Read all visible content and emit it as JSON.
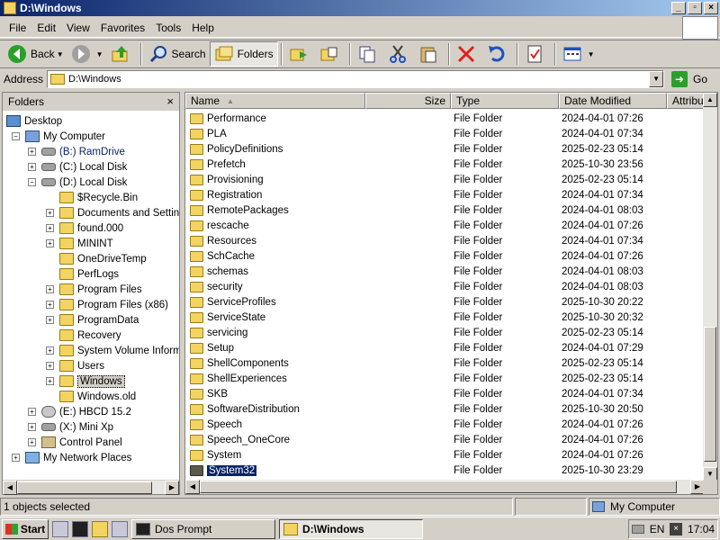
{
  "window": {
    "title": "D:\\Windows"
  },
  "menu": [
    "File",
    "Edit",
    "View",
    "Favorites",
    "Tools",
    "Help"
  ],
  "toolbar": {
    "back": "Back",
    "search": "Search",
    "folders": "Folders"
  },
  "address": {
    "label": "Address",
    "value": "D:\\Windows",
    "go": "Go"
  },
  "folders_pane": {
    "title": "Folders",
    "close": "×",
    "tree": [
      {
        "label": "Desktop",
        "icon": "desk",
        "indent": 0,
        "pm": ""
      },
      {
        "label": "My Computer",
        "icon": "pc",
        "indent": 1,
        "pm": "−"
      },
      {
        "label": "(B:) RamDrive",
        "icon": "drive",
        "indent": 2,
        "pm": "+"
      },
      {
        "label": "(C:) Local Disk",
        "icon": "drive",
        "indent": 2,
        "pm": "+"
      },
      {
        "label": "(D:) Local Disk",
        "icon": "drive",
        "indent": 2,
        "pm": "−"
      },
      {
        "label": "$Recycle.Bin",
        "icon": "folder",
        "indent": 3,
        "pm": ""
      },
      {
        "label": "Documents and Settings",
        "icon": "folder",
        "indent": 3,
        "pm": "+"
      },
      {
        "label": "found.000",
        "icon": "folder",
        "indent": 3,
        "pm": "+"
      },
      {
        "label": "MININT",
        "icon": "folder",
        "indent": 3,
        "pm": "+"
      },
      {
        "label": "OneDriveTemp",
        "icon": "folder",
        "indent": 3,
        "pm": ""
      },
      {
        "label": "PerfLogs",
        "icon": "folder",
        "indent": 3,
        "pm": ""
      },
      {
        "label": "Program Files",
        "icon": "folder",
        "indent": 3,
        "pm": "+"
      },
      {
        "label": "Program Files (x86)",
        "icon": "folder",
        "indent": 3,
        "pm": "+"
      },
      {
        "label": "ProgramData",
        "icon": "folder",
        "indent": 3,
        "pm": "+"
      },
      {
        "label": "Recovery",
        "icon": "folder",
        "indent": 3,
        "pm": ""
      },
      {
        "label": "System Volume Informati",
        "icon": "folder",
        "indent": 3,
        "pm": "+"
      },
      {
        "label": "Users",
        "icon": "folder",
        "indent": 3,
        "pm": "+"
      },
      {
        "label": "Windows",
        "icon": "folder",
        "indent": 3,
        "pm": "+",
        "selected": true
      },
      {
        "label": "Windows.old",
        "icon": "folder",
        "indent": 3,
        "pm": ""
      },
      {
        "label": "(E:) HBCD 15.2",
        "icon": "cd",
        "indent": 2,
        "pm": "+"
      },
      {
        "label": "(X:) Mini Xp",
        "icon": "drive",
        "indent": 2,
        "pm": "+"
      },
      {
        "label": "Control Panel",
        "icon": "cp",
        "indent": 2,
        "pm": "+"
      },
      {
        "label": "My Network Places",
        "icon": "net",
        "indent": 1,
        "pm": "+"
      }
    ]
  },
  "list": {
    "columns": {
      "name": "Name",
      "size": "Size",
      "type": "Type",
      "modified": "Date Modified",
      "attrib": "Attribut"
    },
    "rows": [
      {
        "name": "Performance",
        "type": "File Folder",
        "modified": "2024-04-01 07:26"
      },
      {
        "name": "PLA",
        "type": "File Folder",
        "modified": "2024-04-01 07:34"
      },
      {
        "name": "PolicyDefinitions",
        "type": "File Folder",
        "modified": "2025-02-23 05:14"
      },
      {
        "name": "Prefetch",
        "type": "File Folder",
        "modified": "2025-10-30 23:56"
      },
      {
        "name": "Provisioning",
        "type": "File Folder",
        "modified": "2025-02-23 05:14"
      },
      {
        "name": "Registration",
        "type": "File Folder",
        "modified": "2024-04-01 07:34"
      },
      {
        "name": "RemotePackages",
        "type": "File Folder",
        "modified": "2024-04-01 08:03"
      },
      {
        "name": "rescache",
        "type": "File Folder",
        "modified": "2024-04-01 07:26"
      },
      {
        "name": "Resources",
        "type": "File Folder",
        "modified": "2024-04-01 07:34"
      },
      {
        "name": "SchCache",
        "type": "File Folder",
        "modified": "2024-04-01 07:26"
      },
      {
        "name": "schemas",
        "type": "File Folder",
        "modified": "2024-04-01 08:03"
      },
      {
        "name": "security",
        "type": "File Folder",
        "modified": "2024-04-01 08:03"
      },
      {
        "name": "ServiceProfiles",
        "type": "File Folder",
        "modified": "2025-10-30 20:22"
      },
      {
        "name": "ServiceState",
        "type": "File Folder",
        "modified": "2025-10-30 20:32"
      },
      {
        "name": "servicing",
        "type": "File Folder",
        "modified": "2025-02-23 05:14"
      },
      {
        "name": "Setup",
        "type": "File Folder",
        "modified": "2024-04-01 07:29"
      },
      {
        "name": "ShellComponents",
        "type": "File Folder",
        "modified": "2025-02-23 05:14"
      },
      {
        "name": "ShellExperiences",
        "type": "File Folder",
        "modified": "2025-02-23 05:14"
      },
      {
        "name": "SKB",
        "type": "File Folder",
        "modified": "2024-04-01 07:34"
      },
      {
        "name": "SoftwareDistribution",
        "type": "File Folder",
        "modified": "2025-10-30 20:50"
      },
      {
        "name": "Speech",
        "type": "File Folder",
        "modified": "2024-04-01 07:26"
      },
      {
        "name": "Speech_OneCore",
        "type": "File Folder",
        "modified": "2024-04-01 07:26"
      },
      {
        "name": "System",
        "type": "File Folder",
        "modified": "2024-04-01 07:26"
      },
      {
        "name": "System32",
        "type": "File Folder",
        "modified": "2025-10-30 23:29",
        "selected": true
      }
    ]
  },
  "status": {
    "selection": "1 objects selected",
    "zone": "My Computer"
  },
  "taskbar": {
    "start": "Start",
    "task1": "Dos Prompt",
    "task2": "D:\\Windows",
    "lang": "EN",
    "clock": "17:04"
  },
  "colors": {
    "title_start": "#0a246a",
    "title_end": "#a6caf0",
    "selection": "#0a246a",
    "folder": "#f2d463"
  }
}
